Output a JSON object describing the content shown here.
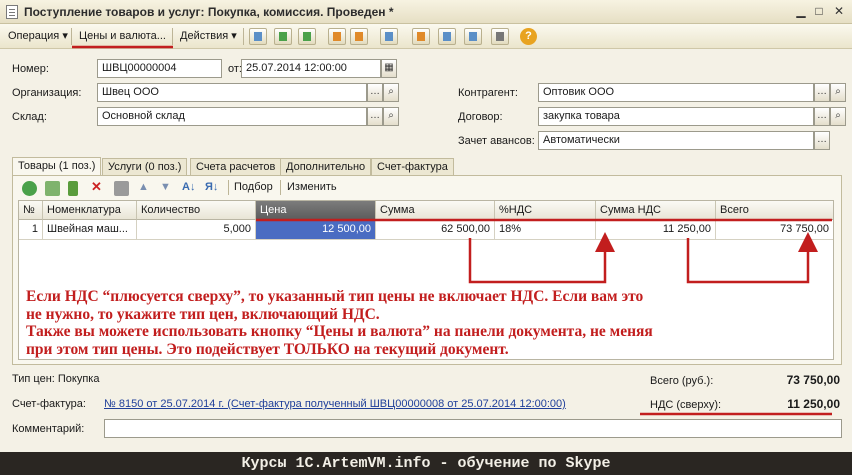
{
  "window": {
    "title": "Поступление товаров и услуг: Покупка, комиссия. Проведен *"
  },
  "toolbar": {
    "operation": "Операция ▾",
    "prices": "Цены и валюта...",
    "actions": "Действия ▾",
    "help": "?"
  },
  "header": {
    "number_label": "Номер:",
    "number_value": "ШВЦ00000004",
    "date_label": "от:",
    "date_value": "25.07.2014 12:00:00",
    "org_label": "Организация:",
    "org_value": "Швец ООО",
    "warehouse_label": "Склад:",
    "warehouse_value": "Основной склад",
    "contractor_label": "Контрагент:",
    "contractor_value": "Оптовик ООО",
    "contract_label": "Договор:",
    "contract_value": "закупка товара",
    "advances_label": "Зачет авансов:",
    "advances_value": "Автоматически"
  },
  "tabs": [
    "Товары (1 поз.)",
    "Услуги (0 поз.)",
    "Счета расчетов",
    "Дополнительно",
    "Счет-фактура"
  ],
  "subtoolbar": {
    "selection": "Подбор",
    "change": "Изменить"
  },
  "table": {
    "columns": [
      "№",
      "Номенклатура",
      "Количество",
      "Цена",
      "Сумма",
      "%НДС",
      "Сумма НДС",
      "Всего"
    ],
    "rows": [
      [
        "1",
        "Швейная маш...",
        "5,000",
        "12 500,00",
        "62 500,00",
        "18%",
        "11 250,00",
        "73 750,00"
      ]
    ]
  },
  "overlay": {
    "lines": [
      "Если НДС “плюсуется сверху”, то указанный тип цены не включает НДС. Если вам это",
      "не нужно, то укажите тип цен, включающий НДС.",
      "Также вы можете использовать кнопку “Цены и валюта” на панели документа, не меняя",
      "при этом тип цены. Это подействует ТОЛЬКО на текущий документ."
    ]
  },
  "footer": {
    "price_type": "Тип цен: Покупка",
    "total_label": "Всего (руб.):",
    "total_value": "73 750,00",
    "vat_label": "НДС (сверху):",
    "vat_value": "11 250,00",
    "invoice_label": "Счет-фактура:",
    "invoice_link": "№ 8150 от 25.07.2014 г. (Счет-фактура полученный ШВЦ00000008 от 25.07.2014 12:00:00)",
    "comment_label": "Комментарий:",
    "comment_value": ""
  },
  "banner": "Курсы 1С.ArtemVM.info - обучение по Skype",
  "colors": {
    "annotation": "#c21e1e",
    "selected_cell": "#4a6cc2",
    "help_button": "#e8a321"
  }
}
